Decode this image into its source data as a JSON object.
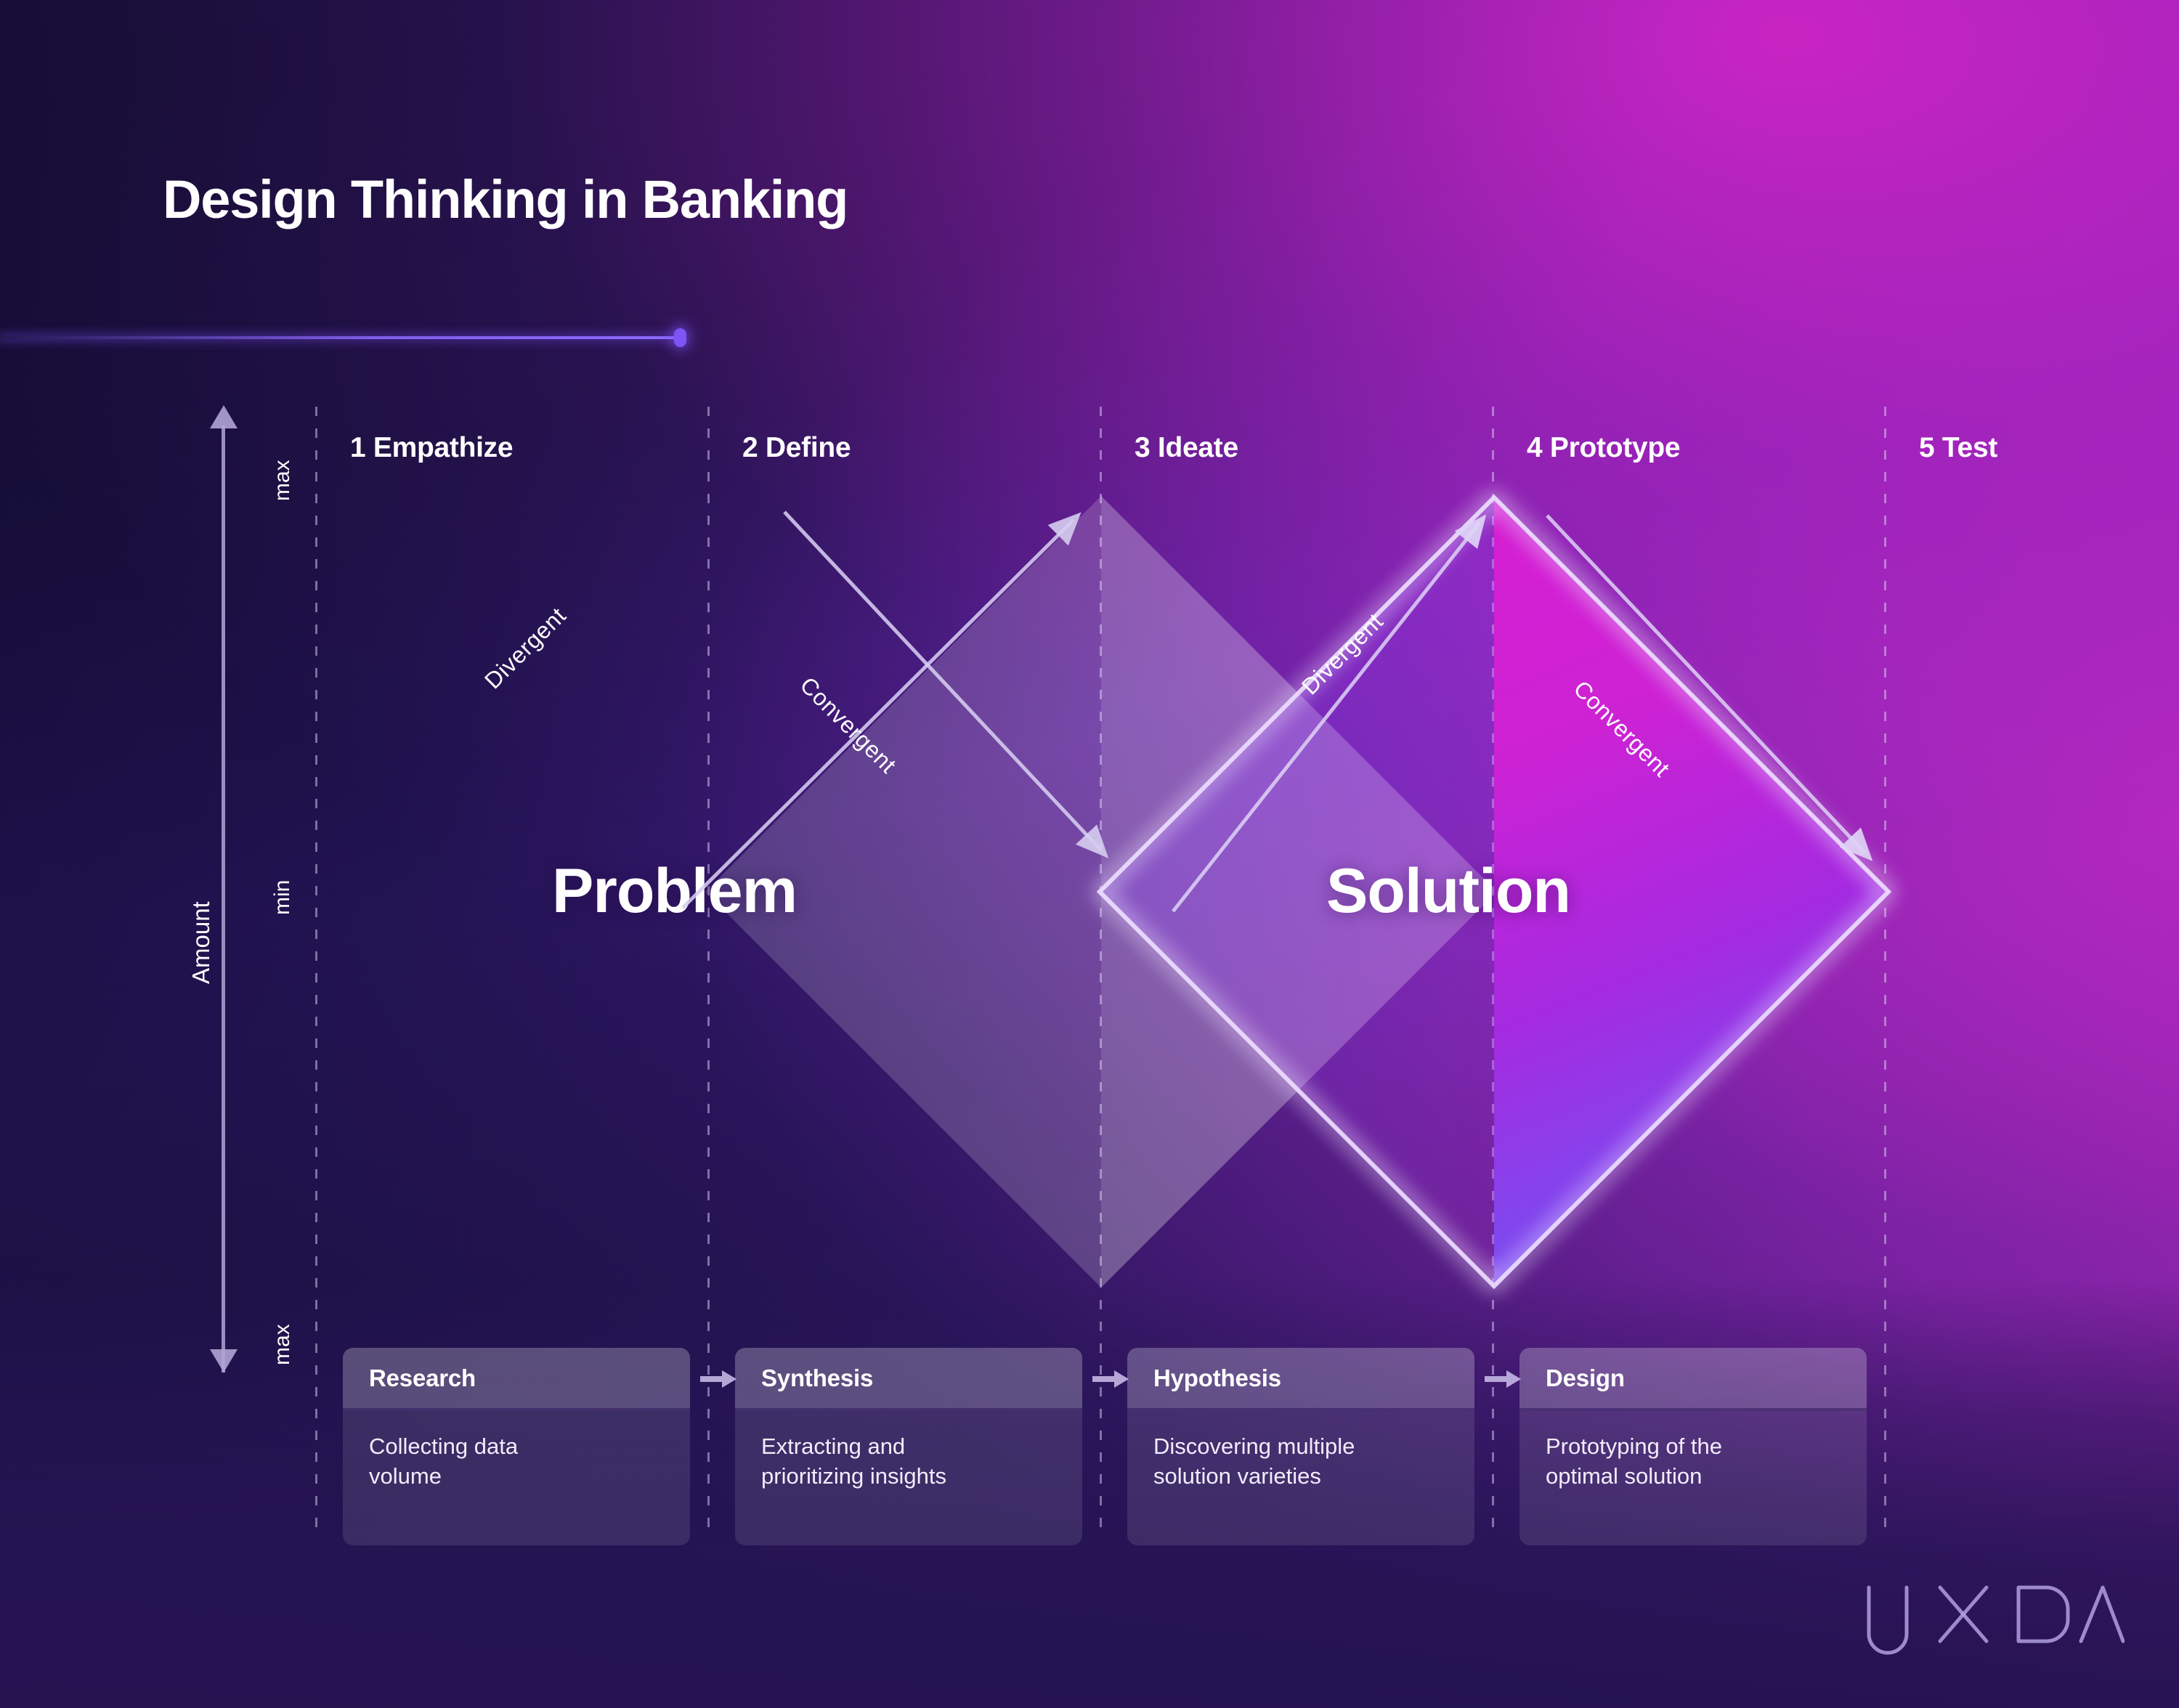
{
  "title": "Design Thinking in Banking",
  "axis": {
    "label": "Amount",
    "max_top": "max",
    "min_mid": "min",
    "max_bottom": "max"
  },
  "stages": [
    {
      "label": "1 Empathize"
    },
    {
      "label": "2 Define"
    },
    {
      "label": "3 Ideate"
    },
    {
      "label": "4 Prototype"
    },
    {
      "label": "5 Test"
    }
  ],
  "diamonds": [
    {
      "title": "Problem",
      "left_label": "Divergent",
      "right_label": "Convergent"
    },
    {
      "title": "Solution",
      "left_label": "Divergent",
      "right_label": "Convergent"
    }
  ],
  "cards": [
    {
      "header": "Research",
      "body": "Collecting data\nvolume"
    },
    {
      "header": "Synthesis",
      "body": "Extracting and\nprioritizing insights"
    },
    {
      "header": "Hypothesis",
      "body": "Discovering multiple\nsolution varieties"
    },
    {
      "header": "Design",
      "body": "Prototyping of the\noptimal solution"
    }
  ],
  "logo": {
    "name": "UXDA"
  },
  "colors": {
    "bg_dark": "#150c3a",
    "bg_mid": "#4a1d91",
    "bg_bright": "#c028c4",
    "accent_line": "#7e54f5",
    "solution_fill": "#d61fd2",
    "solution_fill_2": "#6a5bf2",
    "text": "#ffffff",
    "card_surface": "rgba(255,255,255,0.11)",
    "grid": "rgba(226,214,250,0.48)"
  }
}
